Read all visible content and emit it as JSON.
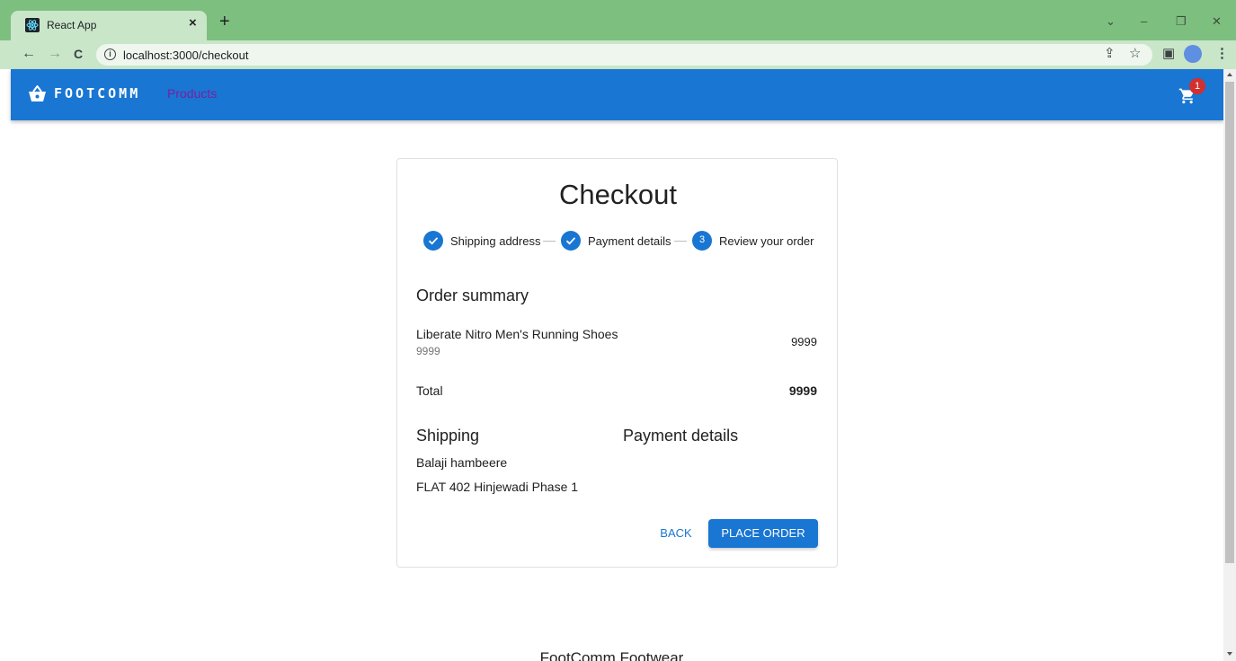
{
  "browser": {
    "tab_title": "React App",
    "tab_close": "×",
    "new_tab": "+",
    "url": "localhost:3000/checkout",
    "back_glyph": "←",
    "forward_glyph": "→",
    "reload_glyph": "C",
    "minimize_glyph": "–",
    "restore_glyph": "❐",
    "close_glyph": "✕",
    "tablist_glyph": "⌄",
    "share_glyph": "⇪",
    "star_glyph": "☆",
    "sidepanel_glyph": "▣",
    "menu_glyph": "⋮"
  },
  "appbar": {
    "brand": "FOOTCOMM",
    "products_link": "Products",
    "cart_count": "1",
    "bg_color": "#1976d2"
  },
  "checkout": {
    "title": "Checkout",
    "steps": [
      {
        "label": "Shipping address",
        "state": "completed"
      },
      {
        "label": "Payment details",
        "state": "completed"
      },
      {
        "label": "Review your order",
        "state": "active",
        "number": "3"
      }
    ],
    "order_summary_title": "Order summary",
    "item": {
      "name": "Liberate Nitro Men's Running Shoes",
      "sub": "9999",
      "price": "9999"
    },
    "total_label": "Total",
    "total_value": "9999",
    "shipping_title": "Shipping",
    "payment_title": "Payment details",
    "shipping_name": "Balaji hambeere",
    "shipping_address": "FLAT 402 Hinjewadi Phase 1",
    "back_label": "BACK",
    "place_order_label": "PLACE ORDER"
  },
  "footer": {
    "text": "FootComm Footwear"
  }
}
